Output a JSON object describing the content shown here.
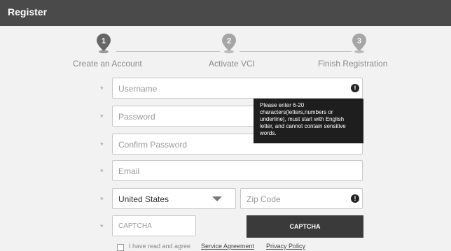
{
  "window": {
    "title": "Register"
  },
  "steps": [
    {
      "number": "1",
      "label": "Create an Account"
    },
    {
      "number": "2",
      "label": "Activate VCI"
    },
    {
      "number": "3",
      "label": "Finish Registration"
    }
  ],
  "form": {
    "required_mark": "*",
    "username": {
      "placeholder": "Username"
    },
    "password": {
      "placeholder": "Password"
    },
    "confirm_password": {
      "placeholder": "Confirm Password"
    },
    "email": {
      "placeholder": "Email"
    },
    "country": {
      "value": "United States"
    },
    "zip": {
      "placeholder": "Zip Code"
    },
    "captcha": {
      "placeholder": "CAPTCHA",
      "button_label": "CAPTCHA"
    },
    "alert_icon": "!",
    "tooltip": "Please enter 6-20 characters(letters,numbers or underline), must start with English letter, and cannot contain sensitive words.",
    "agreement": {
      "text": "I have read and agree",
      "link_service": "Service Agreement",
      "link_privacy": "Privacy Policy"
    }
  },
  "colors": {
    "titlebar": "#4a4a4a",
    "step_pin_inactive": "#a6a6a6",
    "step_pin_active": "#666666",
    "button": "#3a3a3a",
    "tooltip": "#1e1e1e"
  },
  "icons": {
    "step_pin": "map-pin-icon",
    "alert": "exclamation-circle-icon",
    "dropdown": "caret-down-icon",
    "checkbox": "checkbox-icon"
  }
}
